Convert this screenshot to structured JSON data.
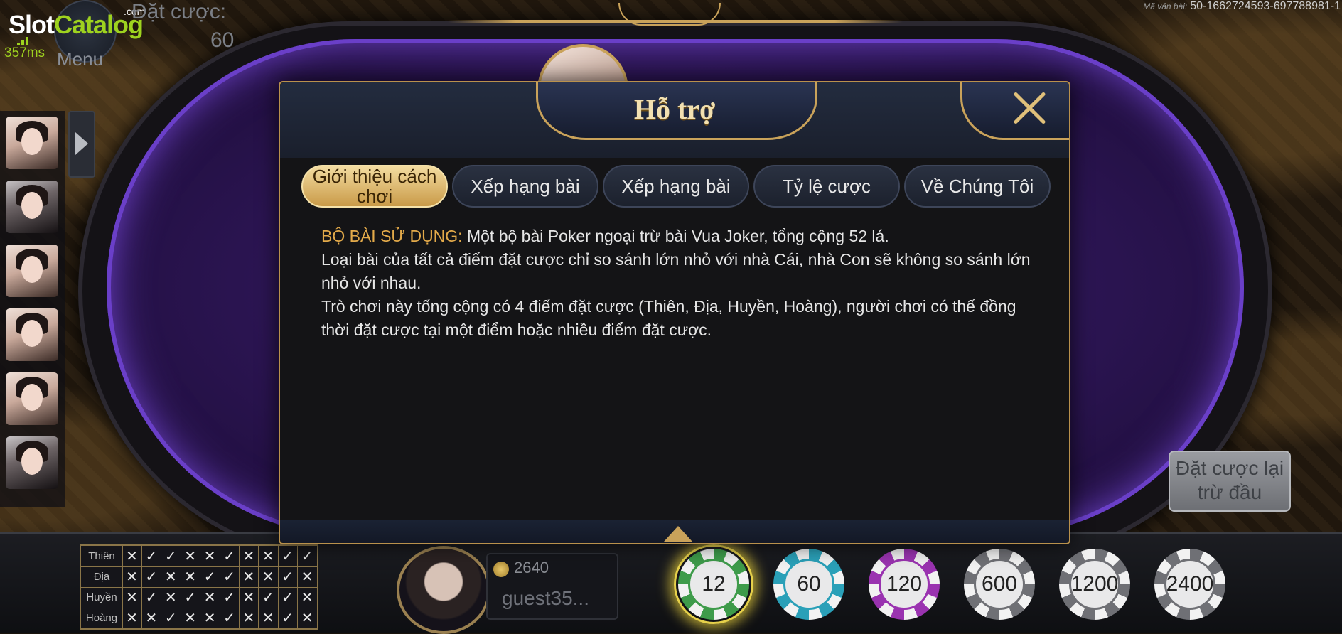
{
  "watermark": {
    "slot": "Slot",
    "catalog": "Catalog",
    "com": ".com"
  },
  "latency": "357ms",
  "menu": {
    "label": "Menu"
  },
  "bet": {
    "label": "Đặt cược:",
    "value": "60"
  },
  "round": {
    "label": "Mã ván bài:",
    "value": "50-1662724593-697788981-1"
  },
  "rebet_button": {
    "label": "Đặt cược lại trừ đầu"
  },
  "modal": {
    "title": "Hỗ trợ",
    "tabs": [
      {
        "label": "Giới thiệu cách chơi",
        "active": true
      },
      {
        "label": "Xếp hạng bài",
        "active": false
      },
      {
        "label": "Xếp hạng bài",
        "active": false
      },
      {
        "label": "Tỷ lệ cược",
        "active": false
      },
      {
        "label": "Về Chúng Tôi",
        "active": false
      }
    ],
    "content": {
      "heading": "BỘ BÀI SỬ DỤNG:",
      "line1": "Một bộ bài Poker ngoại trừ bài Vua Joker, tổng cộng 52 lá.",
      "line2": "Loại bài của tất cả điểm đặt cược chỉ so sánh lớn nhỏ với nhà Cái, nhà Con sẽ không so sánh lớn nhỏ với nhau.",
      "line3": "Trò chơi này tổng cộng có 4 điểm đặt cược (Thiên, Địa, Huyền, Hoàng), người chơi có thể đồng thời đặt cược tại một điểm hoặc nhiều điểm đặt cược."
    }
  },
  "history": {
    "rows": [
      {
        "label": "Thiên",
        "marks": [
          "✕",
          "✓",
          "✓",
          "✕",
          "✕",
          "✓",
          "✕",
          "✕",
          "✓",
          "✓"
        ]
      },
      {
        "label": "Địa",
        "marks": [
          "✕",
          "✓",
          "✕",
          "✕",
          "✓",
          "✓",
          "✕",
          "✕",
          "✓",
          "✕"
        ]
      },
      {
        "label": "Huyền",
        "marks": [
          "✕",
          "✓",
          "✕",
          "✓",
          "✕",
          "✓",
          "✕",
          "✓",
          "✓",
          "✕"
        ]
      },
      {
        "label": "Hoàng",
        "marks": [
          "✕",
          "✕",
          "✓",
          "✕",
          "✕",
          "✓",
          "✕",
          "✕",
          "✓",
          "✕"
        ]
      }
    ]
  },
  "player": {
    "balance": "2640",
    "name": "guest35..."
  },
  "chips": [
    {
      "value": "12",
      "color": "#3e9b4a",
      "selected": true
    },
    {
      "value": "60",
      "color": "#2aa0b8",
      "selected": false
    },
    {
      "value": "120",
      "color": "#9a33b0",
      "selected": false
    },
    {
      "value": "600",
      "color": "#6f7075",
      "selected": false
    },
    {
      "value": "1200",
      "color": "#6f7075",
      "selected": false
    },
    {
      "value": "2400",
      "color": "#6f7075",
      "selected": false
    }
  ]
}
